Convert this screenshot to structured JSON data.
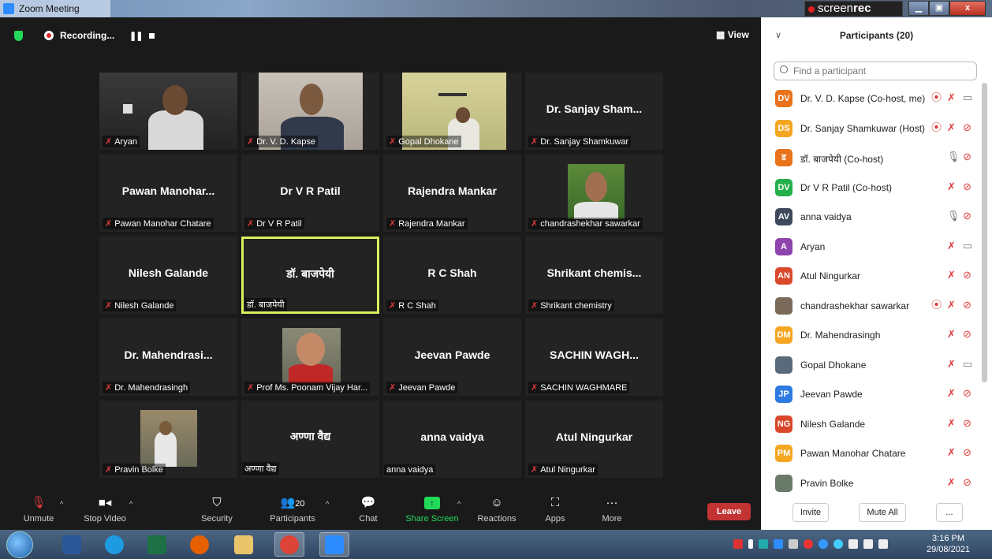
{
  "window": {
    "title": "Zoom Meeting"
  },
  "screenrec": {
    "brand_light": "screen",
    "brand_bold": "rec"
  },
  "topbar": {
    "recording_label": "Recording...",
    "view_label": "View"
  },
  "tiles": [
    {
      "label": "Aryan",
      "muted": true,
      "video": true
    },
    {
      "label": "Dr. V. D. Kapse",
      "muted": true,
      "video": true
    },
    {
      "label": "Gopal Dhokane",
      "muted": true,
      "video": true
    },
    {
      "name": "Dr. Sanjay Sham...",
      "label": "Dr. Sanjay Shamkuwar",
      "muted": true
    },
    {
      "name": "Pawan  Manohar...",
      "label": "Pawan Manohar Chatare",
      "muted": true
    },
    {
      "name": "Dr V R Patil",
      "label": "Dr V R Patil",
      "muted": true
    },
    {
      "name": "Rajendra Mankar",
      "label": "Rajendra Mankar",
      "muted": true
    },
    {
      "label": "chandrashekhar sawarkar",
      "muted": true,
      "video": true
    },
    {
      "name": "Nilesh Galande",
      "label": "Nilesh Galande",
      "muted": true
    },
    {
      "name": "डॉ. बाजपेयी",
      "label": "डॉ. बाजपेयी",
      "muted": false,
      "active": true
    },
    {
      "name": "R C Shah",
      "label": "R C Shah",
      "muted": true
    },
    {
      "name": "Shrikant  chemis...",
      "label": "Shrikant chemistry",
      "muted": true
    },
    {
      "name": "Dr.  Mahendrasi...",
      "label": "Dr. Mahendrasingh",
      "muted": true
    },
    {
      "label": "Prof Ms. Poonam Vijay Har...",
      "muted": true,
      "video": true
    },
    {
      "name": "Jeevan Pawde",
      "label": "Jeevan Pawde",
      "muted": true
    },
    {
      "name": "SACHIN  WAGH...",
      "label": "SACHIN WAGHMARE",
      "muted": true
    },
    {
      "label": "Pravin Bolke",
      "muted": true,
      "video": true
    },
    {
      "name": "अण्णा वैद्य",
      "label": "अण्णा वैद्य",
      "muted": false
    },
    {
      "name": "anna vaidya",
      "label": "anna vaidya",
      "muted": false
    },
    {
      "name": "Atul Ningurkar",
      "label": "Atul Ningurkar",
      "muted": true
    }
  ],
  "toolbar": {
    "unmute": "Unmute",
    "stop_video": "Stop Video",
    "security": "Security",
    "participants": "Participants",
    "participants_count": "20",
    "chat": "Chat",
    "share_screen": "Share Screen",
    "reactions": "Reactions",
    "apps": "Apps",
    "more": "More",
    "leave": "Leave"
  },
  "panel": {
    "title": "Participants (20)",
    "search_placeholder": "Find a participant",
    "participants": [
      {
        "initials": "DV",
        "color": "#e8731a",
        "name": "Dr. V. D. Kapse (Co-host, me)",
        "recording": true,
        "cam": "on"
      },
      {
        "initials": "DS",
        "color": "#f5a623",
        "name": "Dr. Sanjay Shamkuwar (Host)",
        "recording": true,
        "cam": "off"
      },
      {
        "initials": "ड",
        "color": "#e8731a",
        "name": "डॉ. बाजपेयी (Co-host)",
        "mic": "on",
        "cam": "off"
      },
      {
        "initials": "DV",
        "color": "#23b04a",
        "name": "Dr V R Patil (Co-host)",
        "cam": "off"
      },
      {
        "initials": "AV",
        "color": "#3d4a5c",
        "name": "anna vaidya",
        "mic": "on",
        "cam": "off"
      },
      {
        "initials": "A",
        "color": "#8e44ad",
        "name": "Aryan",
        "cam": "on"
      },
      {
        "initials": "AN",
        "color": "#d9482b",
        "name": "Atul Ningurkar",
        "cam": "off"
      },
      {
        "initials": "",
        "color": "#7a6a5a",
        "name": "chandrashekhar sawarkar",
        "recording": true,
        "cam": "off",
        "photo": true
      },
      {
        "initials": "DM",
        "color": "#f5a623",
        "name": "Dr. Mahendrasingh",
        "cam": "off"
      },
      {
        "initials": "",
        "color": "#5a6a7a",
        "name": "Gopal Dhokane",
        "cam": "on",
        "photo": true
      },
      {
        "initials": "JP",
        "color": "#2d7be0",
        "name": "Jeevan Pawde",
        "cam": "off"
      },
      {
        "initials": "NG",
        "color": "#d9482b",
        "name": "Nilesh Galande",
        "cam": "off"
      },
      {
        "initials": "PM",
        "color": "#f5a623",
        "name": "Pawan Manohar Chatare",
        "cam": "off"
      },
      {
        "initials": "",
        "color": "#6a7a6a",
        "name": "Pravin Bolke",
        "cam": "off",
        "photo": true
      }
    ],
    "invite": "Invite",
    "mute_all": "Mute All",
    "more": "..."
  },
  "taskbar": {
    "time": "3:16 PM",
    "date": "29/08/2021"
  }
}
